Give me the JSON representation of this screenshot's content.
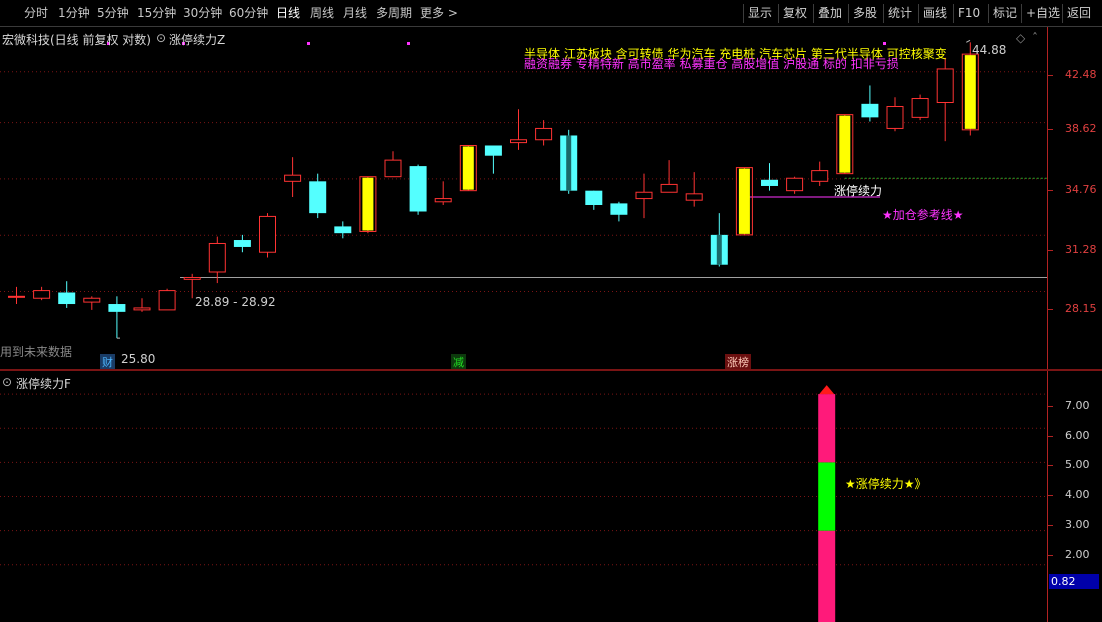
{
  "toolbar": {
    "left": [
      "分时",
      "1分钟",
      "5分钟",
      "15分钟",
      "30分钟",
      "60分钟",
      "日线",
      "周线",
      "月线",
      "多周期",
      "更多 >"
    ],
    "active": "日线",
    "right": [
      "显示",
      "复权",
      "叠加",
      "多股",
      "统计",
      "画线",
      "F10",
      "标记",
      "+自选",
      "返回"
    ]
  },
  "main_header": {
    "stock_title": "宏微科技(日线 前复权 对数)",
    "indicator_name": "涨停续力Z"
  },
  "sub_header": {
    "indicator_name": "涨停续力F"
  },
  "overlays": {
    "concepts_line1": "半导体    江苏板块  含可转债 华为汽车 充电桩 汽车芯片 第三代半导体  可控核聚变",
    "concepts_line2": "融资融券 专精特新 高市盈率 私募重仓 高股增值 沪股通 标的 扣非亏损",
    "future_data_note": "用到未来数据",
    "range_label": "28.89 - 28.92",
    "low_label": "25.80",
    "high_label": "44.88",
    "zt_label": "涨停续力",
    "add_ref_label": "★加仓参考线★",
    "sub_label": "★涨停续力★》"
  },
  "markers": [
    {
      "label": "财",
      "color": "#4db6ff"
    },
    {
      "label": "减",
      "color": "#22dd22"
    },
    {
      "label": "涨榜",
      "color": "#ffaa88"
    }
  ],
  "price_axis": {
    "labels": [
      "42.48",
      "38.62",
      "34.76",
      "31.28",
      "28.15"
    ],
    "scale": "log",
    "current_price": "44.88"
  },
  "sub_axis": {
    "labels": [
      "7.00",
      "6.00",
      "5.00",
      "4.00",
      "3.00",
      "2.00"
    ],
    "current_value": "0.82"
  },
  "colors": {
    "up": "#ff3333",
    "down": "#54ffff",
    "limit_up": "#ffff00",
    "magenta": "#ff33ff",
    "grid": "#7a1414"
  },
  "chart_data": {
    "type": "candlestick",
    "scale": "log",
    "ylim": [
      26.0,
      45.5
    ],
    "candles": [
      {
        "o": 27.9,
        "h": 28.4,
        "l": 27.5,
        "c": 27.9
      },
      {
        "o": 27.8,
        "h": 28.4,
        "l": 27.7,
        "c": 28.2
      },
      {
        "o": 28.1,
        "h": 28.7,
        "l": 27.3,
        "c": 27.5
      },
      {
        "o": 27.6,
        "h": 27.9,
        "l": 27.2,
        "c": 27.8
      },
      {
        "o": 27.5,
        "h": 27.9,
        "l": 25.8,
        "c": 27.1
      },
      {
        "o": 27.2,
        "h": 27.8,
        "l": 27.1,
        "c": 27.3
      },
      {
        "o": 27.2,
        "h": 28.3,
        "l": 27.2,
        "c": 28.2
      },
      {
        "o": 28.8,
        "h": 29.1,
        "l": 27.8,
        "c": 28.9
      },
      {
        "o": 29.2,
        "h": 31.2,
        "l": 28.6,
        "c": 30.8
      },
      {
        "o": 31.0,
        "h": 31.3,
        "l": 30.3,
        "c": 30.6
      },
      {
        "o": 30.3,
        "h": 32.6,
        "l": 30.0,
        "c": 32.4
      },
      {
        "o": 34.6,
        "h": 36.2,
        "l": 33.6,
        "c": 35.0
      },
      {
        "o": 34.6,
        "h": 35.1,
        "l": 32.3,
        "c": 32.6
      },
      {
        "o": 31.8,
        "h": 32.1,
        "l": 31.1,
        "c": 31.4
      },
      {
        "o": 31.5,
        "h": 34.9,
        "l": 31.4,
        "c": 34.9,
        "limit": true
      },
      {
        "o": 34.9,
        "h": 36.6,
        "l": 35.0,
        "c": 36.0
      },
      {
        "o": 35.6,
        "h": 35.7,
        "l": 32.5,
        "c": 32.7
      },
      {
        "o": 33.3,
        "h": 34.6,
        "l": 33.1,
        "c": 33.5
      },
      {
        "o": 34.0,
        "h": 37.0,
        "l": 34.0,
        "c": 37.0,
        "limit": true
      },
      {
        "o": 37.0,
        "h": 37.0,
        "l": 35.1,
        "c": 36.3
      },
      {
        "o": 37.2,
        "h": 39.6,
        "l": 36.7,
        "c": 37.4
      },
      {
        "o": 37.4,
        "h": 38.8,
        "l": 37.0,
        "c": 38.2
      },
      {
        "o": 37.7,
        "h": 38.1,
        "l": 33.8,
        "c": 34.0
      },
      {
        "o": 34.0,
        "h": 34.0,
        "l": 32.8,
        "c": 33.1
      },
      {
        "o": 33.2,
        "h": 33.3,
        "l": 32.1,
        "c": 32.5
      },
      {
        "o": 33.5,
        "h": 35.1,
        "l": 32.3,
        "c": 33.9
      },
      {
        "o": 33.9,
        "h": 36.0,
        "l": 33.9,
        "c": 34.4
      },
      {
        "o": 33.4,
        "h": 35.2,
        "l": 33.0,
        "c": 33.8
      },
      {
        "o": 31.3,
        "h": 32.6,
        "l": 29.5,
        "c": 29.6
      },
      {
        "o": 31.3,
        "h": 35.5,
        "l": 31.3,
        "c": 35.5,
        "limit": true
      },
      {
        "o": 34.7,
        "h": 35.8,
        "l": 34.0,
        "c": 34.3
      },
      {
        "o": 34.0,
        "h": 34.9,
        "l": 33.8,
        "c": 34.8
      },
      {
        "o": 34.6,
        "h": 35.9,
        "l": 34.3,
        "c": 35.3
      },
      {
        "o": 35.1,
        "h": 39.2,
        "l": 35.1,
        "c": 39.2,
        "limit": true
      },
      {
        "o": 40.0,
        "h": 41.4,
        "l": 38.7,
        "c": 39.0
      },
      {
        "o": 38.2,
        "h": 40.5,
        "l": 38.0,
        "c": 39.8
      },
      {
        "o": 39.0,
        "h": 40.7,
        "l": 38.8,
        "c": 40.4
      },
      {
        "o": 40.1,
        "h": 43.6,
        "l": 37.3,
        "c": 42.7
      },
      {
        "o": 38.1,
        "h": 44.88,
        "l": 37.7,
        "c": 43.9,
        "limit": true
      }
    ],
    "ref_lines": [
      {
        "price": 28.9,
        "label": "28.89 - 28.92"
      },
      {
        "price": 34.8,
        "label": "涨停续力"
      },
      {
        "price": 33.6,
        "label": "★加仓参考线★"
      }
    ],
    "sub_indicator": {
      "ylim": [
        0.5,
        7.5
      ],
      "bar_index": 32,
      "segments": [
        {
          "from": 0.0,
          "to": 3.0,
          "color": "#ff1a7a"
        },
        {
          "from": 3.0,
          "to": 5.0,
          "color": "#00ff00"
        },
        {
          "from": 5.0,
          "to": 7.0,
          "color": "#ff1a7a"
        }
      ]
    }
  }
}
